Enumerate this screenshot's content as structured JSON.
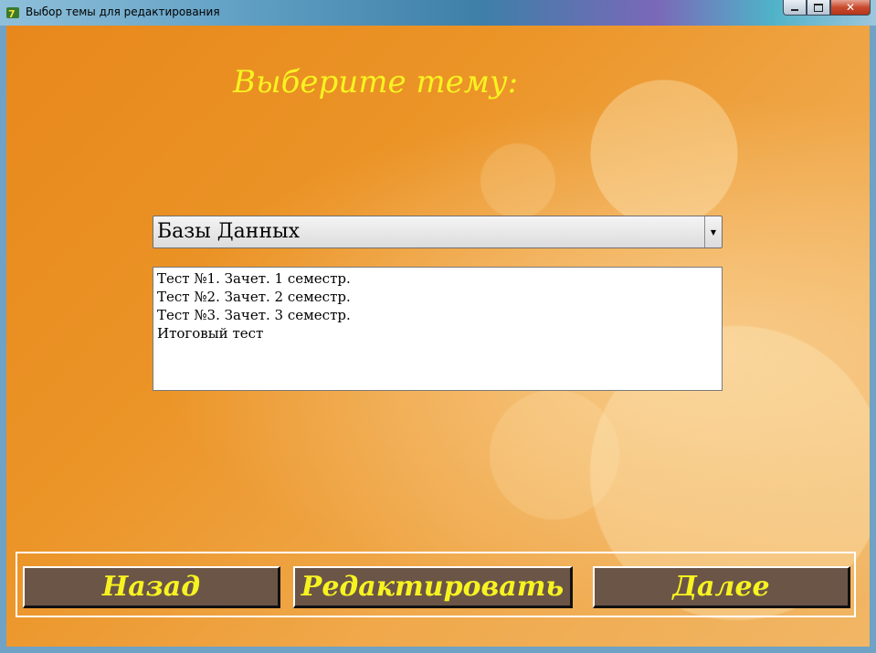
{
  "window": {
    "title": "Выбор темы для редактирования",
    "icon": "app-icon",
    "controls": {
      "minimize": "minimize-icon",
      "maximize": "maximize-icon",
      "close": "✕"
    }
  },
  "main": {
    "heading": "Выберите тему:",
    "topic_select": {
      "selected": "Базы Данных",
      "arrow": "▼"
    },
    "tests": [
      "Тест №1. Зачет. 1 семестр.",
      "Тест №2. Зачет. 2 семестр.",
      "Тест №3. Зачет. 3 семестр.",
      "Итоговый тест"
    ]
  },
  "buttons": {
    "back": "Назад",
    "edit": "Редактировать",
    "next": "Далее"
  },
  "colors": {
    "accent_text": "#f7f321",
    "button_bg": "#6b5547",
    "background": "#eb9427"
  }
}
